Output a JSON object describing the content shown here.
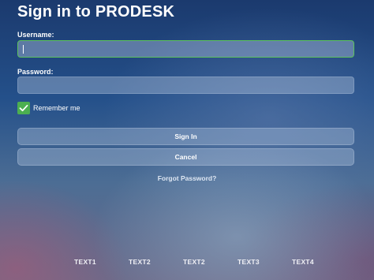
{
  "page": {
    "title": "Sign in to PRODESK"
  },
  "form": {
    "username_label": "Username:",
    "username_value": "",
    "password_label": "Password:",
    "password_value": "",
    "remember_label": "Remember me",
    "remember_checked": true,
    "sign_in_label": "Sign In",
    "cancel_label": "Cancel",
    "forgot_label": "Forgot Password?"
  },
  "footer": {
    "links": [
      "TEXT1",
      "TEXT2",
      "TEXT2",
      "TEXT3",
      "TEXT4"
    ]
  },
  "colors": {
    "accent": "#4caf50",
    "focus_border": "#5cc25c"
  }
}
